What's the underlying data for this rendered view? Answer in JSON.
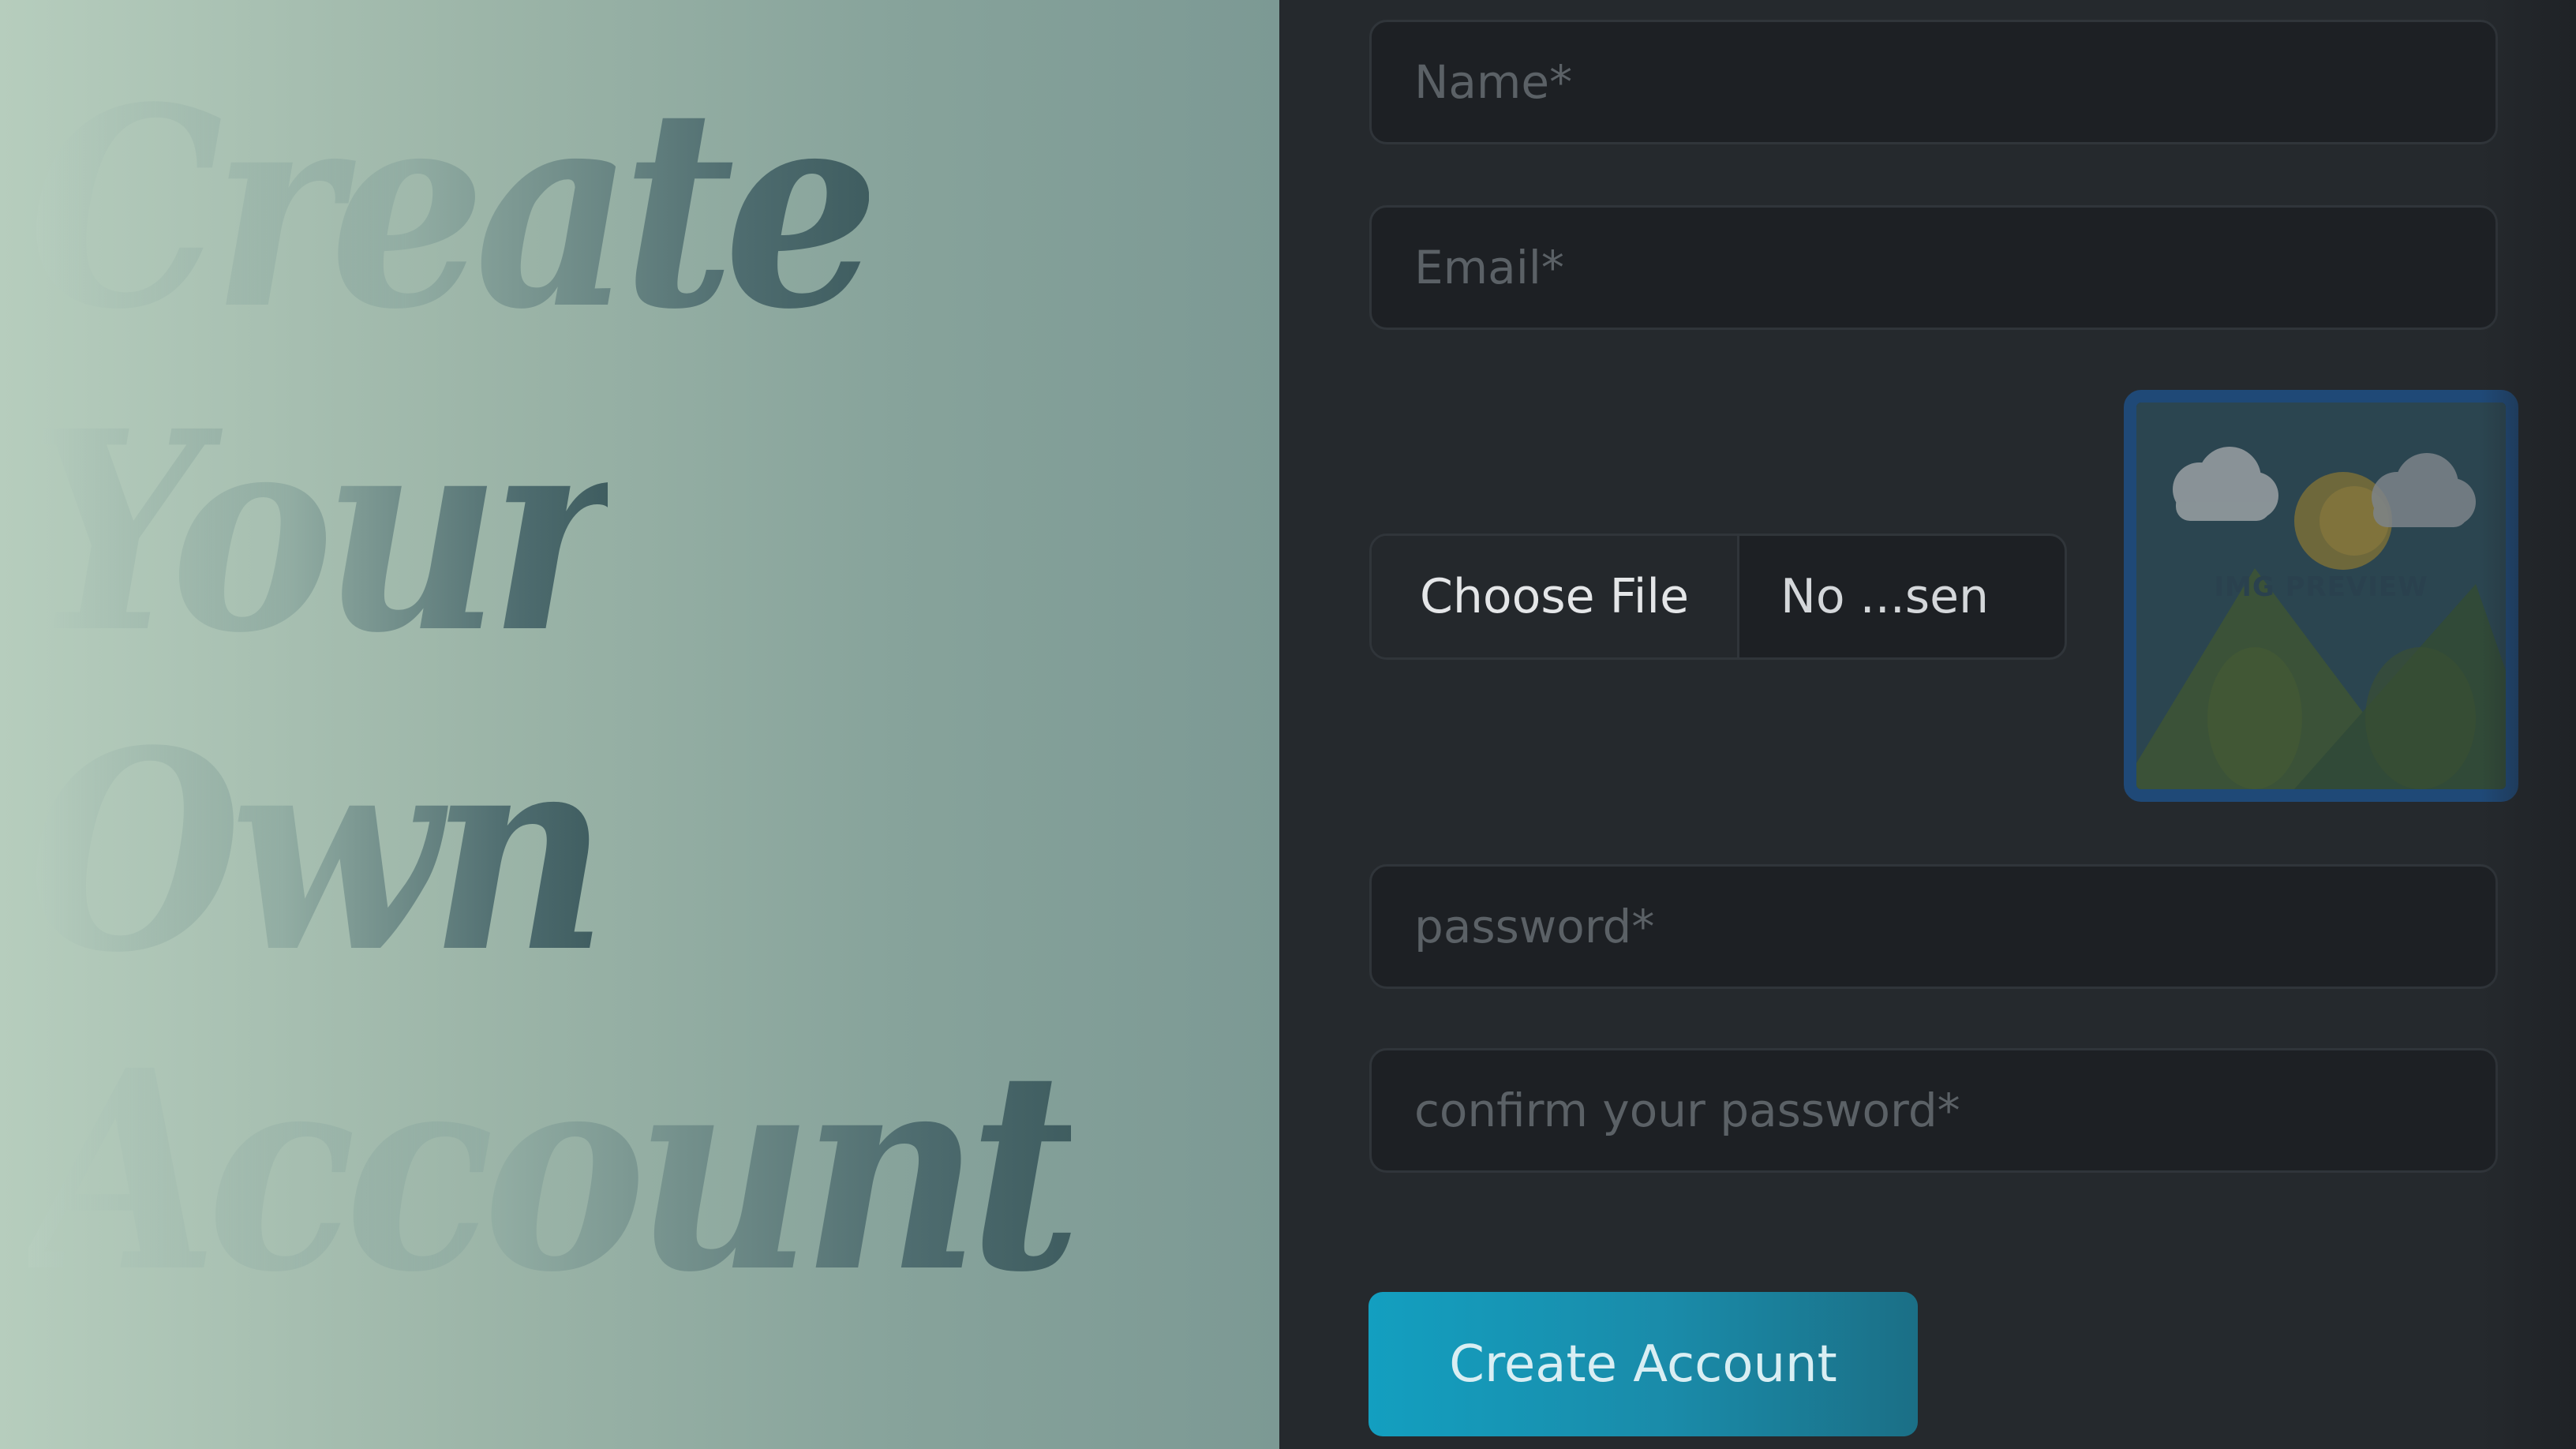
{
  "hero": {
    "lines": [
      "Create",
      "Your",
      "Own",
      "Account"
    ]
  },
  "form": {
    "name_placeholder": "Name*",
    "email_placeholder": "Email*",
    "file_button_label": "Choose File",
    "file_name": "No ...sen",
    "preview_label": "IMG PREVIEW",
    "password_placeholder": "password*",
    "confirm_placeholder": "confirm your password*",
    "submit_label": "Create Account"
  },
  "colors": {
    "hero_start": "#b6cdbd",
    "hero_end": "#7c9994",
    "panel_bg": "#25292d",
    "field_bg": "#1d2024",
    "button_accent": "#139fc0",
    "preview_border": "#1f4f85"
  },
  "icons": {
    "preview_image": "image-placeholder-icon"
  }
}
